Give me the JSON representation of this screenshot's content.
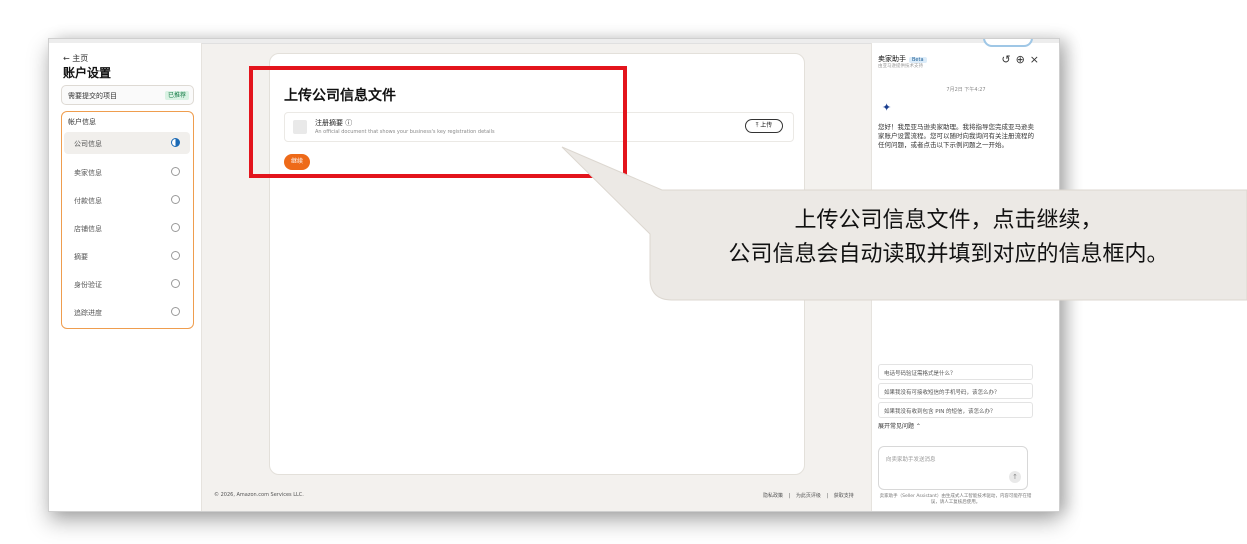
{
  "left_nav": {
    "back": "← 主页",
    "title": "账户设置",
    "pending_label": "需要提交的项目",
    "pending_badge": "已推荐",
    "section": "帐户信息",
    "items": [
      {
        "label": "公司信息",
        "state": "partial"
      },
      {
        "label": "卖家信息",
        "state": "empty"
      },
      {
        "label": "付款信息",
        "state": "empty"
      },
      {
        "label": "店铺信息",
        "state": "empty"
      },
      {
        "label": "摘要",
        "state": "empty"
      },
      {
        "label": "身份验证",
        "state": "empty"
      },
      {
        "label": "追踪进度",
        "state": "empty"
      }
    ]
  },
  "main": {
    "title": "上传公司信息文件",
    "doc_name": "注册摘要 ⓘ",
    "doc_desc": "An official document that shows your business's key registration details",
    "upload_label": "⤒ 上传",
    "continue_label": "继续"
  },
  "footer": {
    "copyright": "© 2026, Amazon.com Services LLC.",
    "links": [
      "隐私政策",
      "|",
      "为此页评级",
      "|",
      "获取支持"
    ]
  },
  "assistant": {
    "title": "卖家助手",
    "beta": "Beta",
    "subtitle": "由亚马逊提供技术支持",
    "icons": [
      "history-icon",
      "new-chat-icon",
      "close-icon"
    ],
    "icon_glyphs": [
      "↺",
      "⊕",
      "×"
    ],
    "time": "7月2日 下午4:27",
    "message": "您好！我是亚马逊卖家助理。我将指导您完成亚马逊卖家账户设置流程。您可以随时向我询问有关注册流程的任何问题，或者点击以下示例问题之一开始。",
    "suggestions": [
      "电话号码验证需格式是什么？",
      "如果我没有可接收短信的手机号码，该怎么办？",
      "如果我没有收到包含 PIN 的短信，该怎么办？"
    ],
    "expand_label": "展开常见问题 ⌃",
    "input_placeholder": "向卖家助手发送消息",
    "disclaimer": "卖家助手（Seller Assistant）由生成式人工智能技术驱动，内容可能存在错误，请人工复核后使用。"
  },
  "callout": {
    "line1": "上传公司信息文件，点击继续，",
    "line2": "公司信息会自动读取并填到对应的信息框内。"
  },
  "colors": {
    "accent": "#ee6a19",
    "highlight_box": "#e3141c",
    "nav_border": "#ef9d4e",
    "radio_active": "#1b6ab5"
  }
}
